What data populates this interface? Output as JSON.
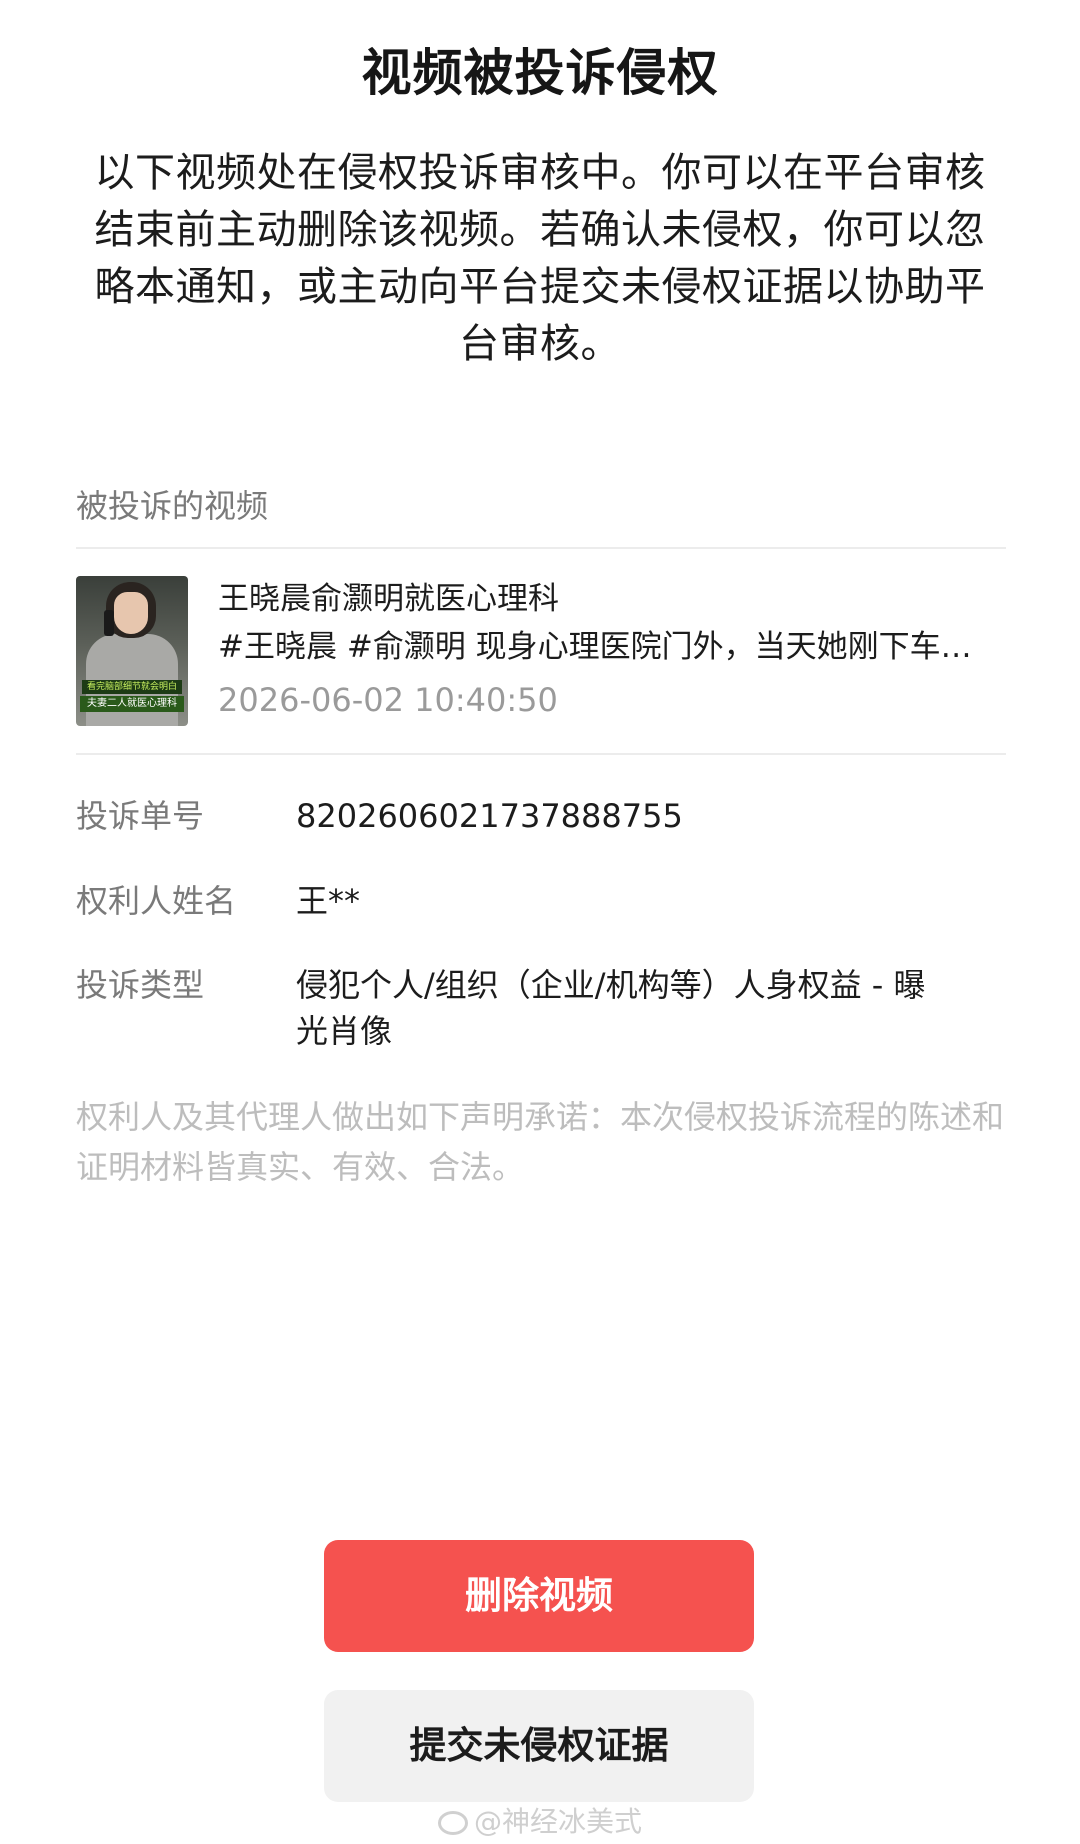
{
  "header": {
    "title": "视频被投诉侵权"
  },
  "intro": {
    "text": "以下视频处在侵权投诉审核中。你可以在平台审核结束前主动删除该视频。若确认未侵权，你可以忽略本通知，或主动向平台提交未侵权证据以协助平台审核。"
  },
  "video_section": {
    "label": "被投诉的视频",
    "thumbnail": {
      "caption_top": "看完脑部细节就会明白",
      "caption_bottom": "夫妻二人就医心理科"
    },
    "title": "王晓晨俞灏明就医心理科",
    "description": "#王晓晨 #俞灏明 现身心理医院门外，当天她刚下车…",
    "timestamp": "2026-06-02 10:40:50"
  },
  "details": [
    {
      "label": "投诉单号",
      "value": "8202606021737888755"
    },
    {
      "label": "权利人姓名",
      "value": "王**"
    },
    {
      "label": "投诉类型",
      "value": "侵犯个人/组织（企业/机构等）人身权益 - 曝光肖像"
    }
  ],
  "statement": {
    "text": "权利人及其代理人做出如下声明承诺：本次侵权投诉流程的陈述和证明材料皆真实、有效、合法。"
  },
  "actions": {
    "delete_label": "删除视频",
    "evidence_label": "提交未侵权证据"
  },
  "watermark": {
    "text": "@神经冰美式"
  },
  "colors": {
    "delete_button": "#f5524f",
    "evidence_button": "#f1f1f1",
    "muted_text": "#7a7a7a",
    "statement_text": "#bdbdbd"
  }
}
